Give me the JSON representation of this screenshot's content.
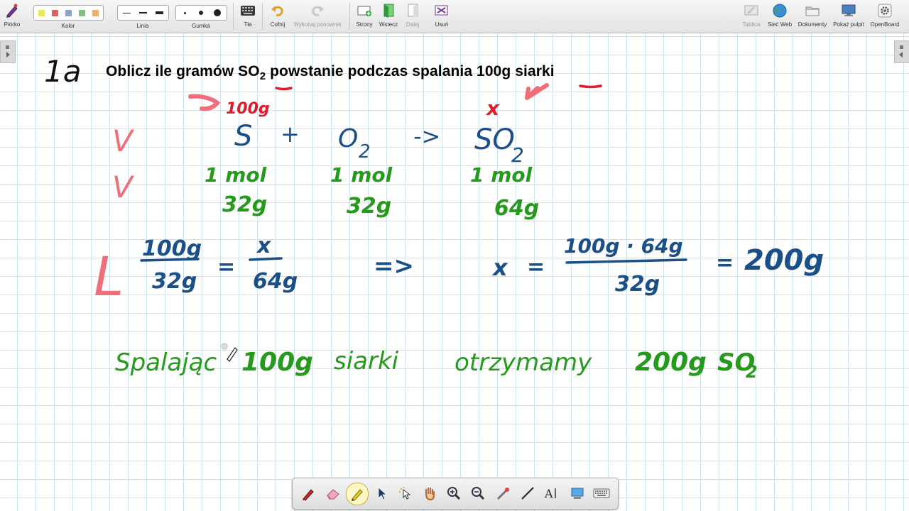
{
  "toolbar": {
    "pen": "Piórko",
    "color": "Kolor",
    "line": "Linia",
    "eraser": "Gumka",
    "background": "Tła",
    "undo": "Cofnij",
    "redo": "Wykonaj ponownie",
    "pages": "Strony",
    "back": "Wstecz",
    "forward": "Dalej",
    "delete": "Usuń",
    "board": "Tablica",
    "web": "Sieć Web",
    "documents": "Dokumenty",
    "desktop": "Pokaż pulpit",
    "openboard": "OpenBoard"
  },
  "colors": {
    "swatches": [
      "#e8e85a",
      "#e06060",
      "#8aa4c8",
      "#7fbf7f",
      "#e8b070"
    ],
    "ink_blue": "#1b4f87",
    "ink_green": "#259a1c",
    "ink_red": "#e01c2c",
    "ink_pink": "#ee6f7a"
  },
  "board": {
    "task_number": "1a",
    "title_before": "Oblicz ile gramów SO",
    "title_sub": "2",
    "title_after": "powstanie podczas spalania 100g siarki",
    "given_mass": "100g",
    "unknown": "x",
    "check_1": "V",
    "check_2": "V",
    "check_3": "L",
    "eq_s": "S",
    "eq_plus": "+",
    "eq_o": "O",
    "eq_o_sub": "2",
    "eq_arrow": "->",
    "eq_so": "SO",
    "eq_so_sub": "2",
    "mol_1": "1 mol",
    "mol_2": "1 mol",
    "mol_3": "1 mol",
    "mass_1": "32g",
    "mass_2": "32g",
    "mass_3": "64g",
    "prop_num_1": "100g",
    "prop_den_1": "32g",
    "prop_eq": "=",
    "prop_num_2": "x",
    "prop_den_2": "64g",
    "implies": "=>",
    "result_x": "x",
    "result_eq": "=",
    "result_num": "100g · 64g",
    "result_den": "32g",
    "result_eq2": "=",
    "result_value": "200g",
    "answer_1": "Spalając",
    "answer_2": "100g",
    "answer_3": "siarki",
    "answer_4": "otrzymamy",
    "answer_5": "200g",
    "answer_6": "SO",
    "answer_6_sub": "2"
  }
}
